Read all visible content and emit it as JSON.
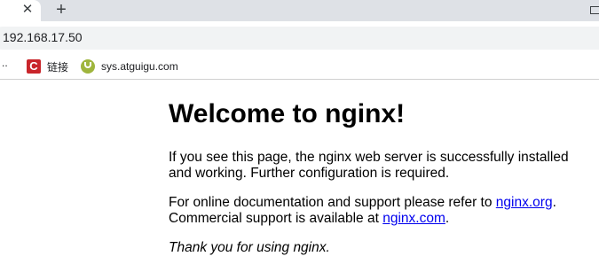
{
  "browser": {
    "tab": {
      "close_glyph": "✕"
    },
    "new_tab_glyph": "+",
    "url": "192.168.17.50",
    "bookmarks": {
      "overflow": "..",
      "items": [
        {
          "label": "链接",
          "icon": "c-logo-icon",
          "icon_color": "#c9252b",
          "icon_glyph": "C"
        },
        {
          "label": "sys.atguigu.com",
          "icon": "u-logo-icon",
          "icon_color": "#9fb53d"
        }
      ]
    }
  },
  "page": {
    "title": "Welcome to nginx!",
    "p1": "If you see this page, the nginx web server is successfully installed and working. Further configuration is required.",
    "p2_prefix": "For online documentation and support please refer to ",
    "p2_link1": "nginx.org",
    "p2_mid": ".",
    "p2_line2": "Commercial support is available at ",
    "p2_link2": "nginx.com",
    "p2_suffix": ".",
    "p3": "Thank you for using nginx.",
    "link_color": "#0000ee"
  }
}
